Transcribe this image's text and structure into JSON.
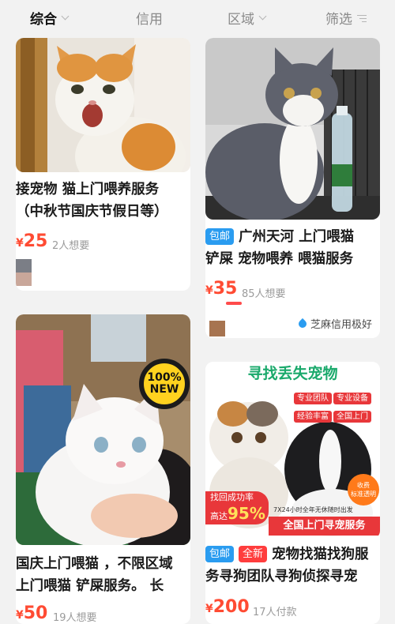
{
  "filters": {
    "comprehensive": "综合",
    "credit": "信用",
    "region": "区域",
    "filter": "筛选"
  },
  "listings": [
    {
      "title_line1": "接宠物 猫上门喂养服务",
      "title_line2": "（中秋节国庆节假日等）",
      "price_symbol": "¥",
      "price": "25",
      "want": "2人想要"
    },
    {
      "tag": "包邮",
      "title_line1": "广州天河 上门喂猫",
      "title_line2": "铲屎 宠物喂养 喂猫服务",
      "price_symbol": "¥",
      "price": "35",
      "want": "85人想要",
      "credit_badge": "芝麻信用极好"
    },
    {
      "title_line1": "国庆上门喂猫 ，不限区域",
      "title_line2": "上门喂猫 铲屎服务。 长",
      "price_symbol": "¥",
      "price": "50",
      "want": "19人想要",
      "image_sticker_line1": "100%",
      "image_sticker_line2": "NEW"
    },
    {
      "tag1": "包邮",
      "tag2": "全新",
      "title_line1": "宠物找猫找狗服",
      "title_line2": "务寻狗团队寻狗侦探寻宠",
      "price_symbol": "¥",
      "price": "200",
      "paid": "17人付款",
      "poster": {
        "headline": "寻找丢失宠物",
        "chips": [
          "专业团队",
          "专业设备",
          "经验丰富",
          "全国上门"
        ],
        "rate_label": "找回成功率",
        "rate_prefix": "高达",
        "rate_value": "95%",
        "hours": "7X24小时全年无休随时出发",
        "banner": "全国上门寻宠服务",
        "fee_line1": "收费",
        "fee_line2": "标准透明"
      }
    }
  ]
}
